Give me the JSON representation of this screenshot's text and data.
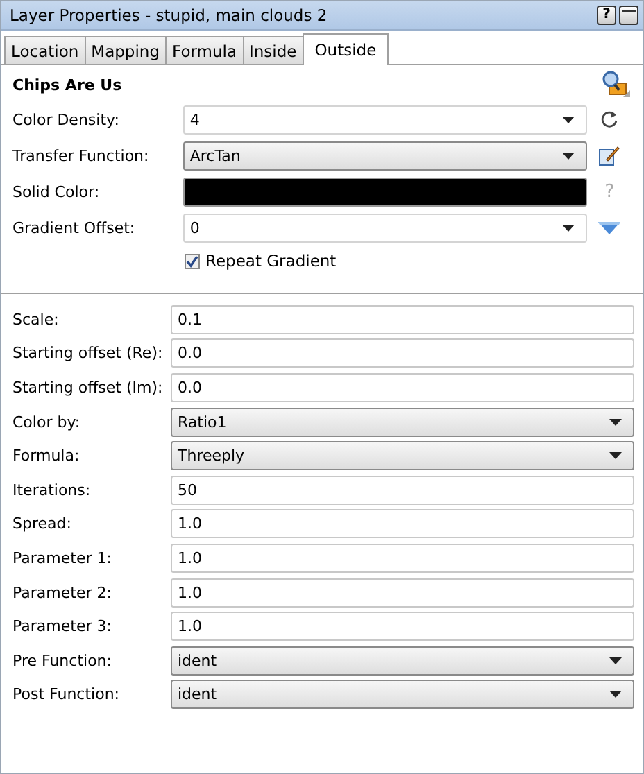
{
  "window": {
    "title": "Layer Properties - stupid, main clouds 2",
    "help_button": "?"
  },
  "tabs": [
    {
      "label": "Location",
      "selected": false
    },
    {
      "label": "Mapping",
      "selected": false
    },
    {
      "label": "Formula",
      "selected": false
    },
    {
      "label": "Inside",
      "selected": false
    },
    {
      "label": "Outside",
      "selected": true
    }
  ],
  "section_title": "Chips Are Us",
  "top_rows": [
    {
      "label": "Color Density:",
      "kind": "combo",
      "value": "4"
    },
    {
      "label": "Transfer Function:",
      "kind": "select",
      "value": "ArcTan"
    },
    {
      "label": "Solid Color:",
      "kind": "color",
      "color": "#000000",
      "side_text": "?"
    },
    {
      "label": "Gradient Offset:",
      "kind": "combo",
      "value": "0"
    }
  ],
  "repeat_gradient": {
    "label": "Repeat Gradient",
    "checked": true
  },
  "params": [
    {
      "label": "Scale:",
      "kind": "text",
      "value": "0.1"
    },
    {
      "label": "Starting offset (Re):",
      "kind": "text",
      "value": "0.0"
    },
    {
      "label": "Starting offset (Im):",
      "kind": "text",
      "value": "0.0"
    },
    {
      "label": "Color by:",
      "kind": "select",
      "value": "Ratio1"
    },
    {
      "label": "Formula:",
      "kind": "select",
      "value": "Threeply"
    },
    {
      "label": "Iterations:",
      "kind": "text",
      "value": "50"
    },
    {
      "label": "Spread:",
      "kind": "text",
      "value": "1.0"
    },
    {
      "label": "Parameter 1:",
      "kind": "text",
      "value": "1.0"
    },
    {
      "label": "Parameter 2:",
      "kind": "text",
      "value": "1.0"
    },
    {
      "label": "Parameter 3:",
      "kind": "text",
      "value": "1.0"
    },
    {
      "label": "Pre Function:",
      "kind": "select",
      "value": "ident"
    },
    {
      "label": "Post Function:",
      "kind": "select",
      "value": "ident"
    }
  ]
}
